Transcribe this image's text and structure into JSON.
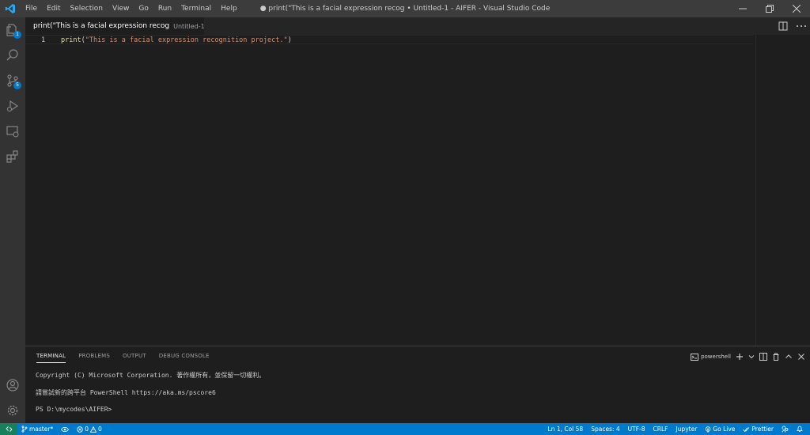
{
  "window": {
    "title": "● print(\"This is a facial expression recog • Untitled-1 - AIFER - Visual Studio Code",
    "menu": [
      "File",
      "Edit",
      "Selection",
      "View",
      "Go",
      "Run",
      "Terminal",
      "Help"
    ]
  },
  "activity_bar": {
    "explorer_badge": "1",
    "source_control_badge": "5"
  },
  "editor": {
    "tab": {
      "label": "print(\"This is a facial expression recog",
      "description": "Untitled-1"
    },
    "lines": [
      {
        "number": "1",
        "fn": "print",
        "open": "(",
        "string": "\"This is a facial expression recognition project.\"",
        "close": ")"
      }
    ]
  },
  "panel": {
    "tabs": [
      "TERMINAL",
      "PROBLEMS",
      "OUTPUT",
      "DEBUG CONSOLE"
    ],
    "active_tab": "TERMINAL",
    "terminal_selector": "powershell",
    "terminal_lines": [
      "Copyright (C) Microsoft Corporation. 著作權所有，並保留一切權利。",
      "請嘗試新的跨平台 PowerShell https://aka.ms/pscore6",
      "PS D:\\mycodes\\AIFER>"
    ]
  },
  "status_bar": {
    "branch": "master*",
    "errors": "0",
    "warnings": "0",
    "position": "Ln 1, Col 58",
    "indent": "Spaces: 4",
    "encoding": "UTF-8",
    "eol": "CRLF",
    "language": "Jupyter",
    "go_live": "Go Live",
    "prettier": "Prettier"
  },
  "colors": {
    "accent": "#007acc",
    "remote": "#16825d",
    "string": "#ce9178",
    "function": "#dcdcaa"
  }
}
